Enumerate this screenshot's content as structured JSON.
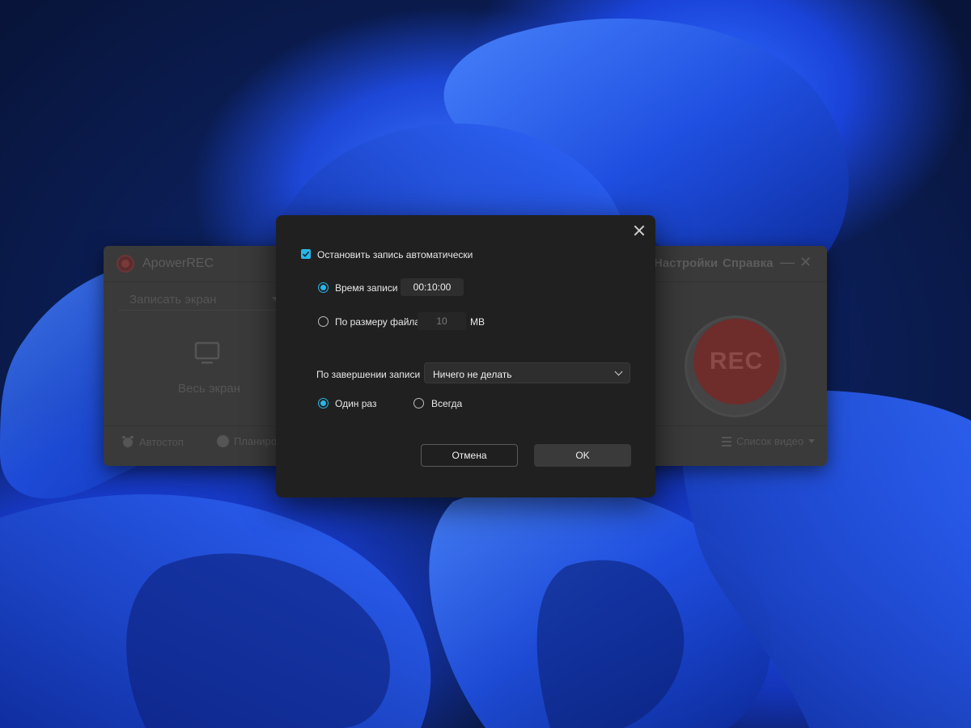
{
  "background_app": {
    "title": "ApowerREC",
    "menu": {
      "settings": "Настройки",
      "help": "Справка"
    },
    "window_controls": {
      "minimize": "—",
      "close": "✕"
    },
    "mode_select": {
      "value": "Записать экран"
    },
    "area_label": "Весь экран",
    "rec_label": "REC",
    "bottom": {
      "autostop": "Автостоп",
      "scheduler": "Планиро",
      "video_list": "Список видео"
    }
  },
  "dialog": {
    "stop_auto": {
      "label": "Остановить запись автоматически",
      "checked": true
    },
    "by_time": {
      "label": "Время записи",
      "value": "00:10:00",
      "selected": true
    },
    "by_size": {
      "label": "По размеру файла",
      "value": "10",
      "unit": "MB",
      "selected": false
    },
    "on_finish": {
      "label": "По завершении записи",
      "value": "Ничего не делать"
    },
    "frequency": {
      "once": {
        "label": "Один раз",
        "selected": true
      },
      "always": {
        "label": "Всегда",
        "selected": false
      }
    },
    "buttons": {
      "cancel": "Отмена",
      "ok": "OK"
    }
  },
  "colors": {
    "accent": "#29b6e8",
    "dialog_bg": "#202020",
    "app_bg": "#3a3a3a",
    "rec_button": "#6e2c2a"
  },
  "icons": [
    "close-icon",
    "checkmark-icon",
    "chevron-down-icon",
    "monitor-icon",
    "alarm-clock-icon",
    "clock-icon",
    "list-icon",
    "apowerrec-logo"
  ]
}
